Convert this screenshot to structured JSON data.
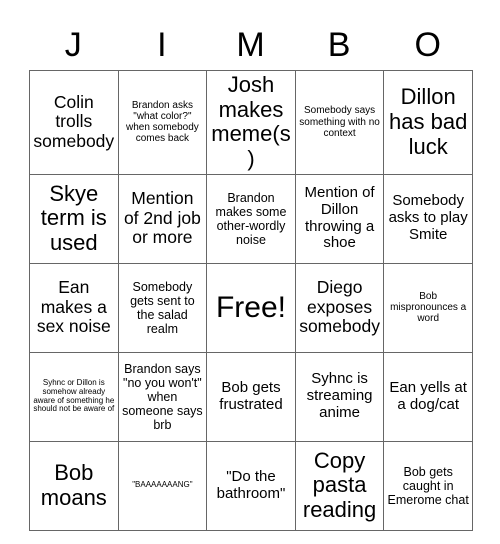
{
  "card": {
    "title_letters": [
      "J",
      "I",
      "M",
      "B",
      "O"
    ],
    "rows": [
      [
        {
          "text": "Colin trolls somebody",
          "size": "fs-lg"
        },
        {
          "text": "Brandon asks \"what color?\" when somebody comes back",
          "size": "fs-xs"
        },
        {
          "text": "Josh makes meme(s)",
          "size": "fs-xl"
        },
        {
          "text": "Somebody says something with no context",
          "size": "fs-xs"
        },
        {
          "text": "Dillon has bad luck",
          "size": "fs-xl"
        }
      ],
      [
        {
          "text": "Skye term is used",
          "size": "fs-xl"
        },
        {
          "text": "Mention of 2nd job or more",
          "size": "fs-lg"
        },
        {
          "text": "Brandon makes some other-wordly noise",
          "size": "fs-sm"
        },
        {
          "text": "Mention of Dillon throwing a shoe",
          "size": "fs-md"
        },
        {
          "text": "Somebody asks to play Smite",
          "size": "fs-md"
        }
      ],
      [
        {
          "text": "Ean makes a sex noise",
          "size": "fs-lg"
        },
        {
          "text": "Somebody gets sent to the salad realm",
          "size": "fs-sm"
        },
        {
          "text": "Free!",
          "size": "fs-free"
        },
        {
          "text": "Diego exposes somebody",
          "size": "fs-lg"
        },
        {
          "text": "Bob mispronounces a word",
          "size": "fs-xs"
        }
      ],
      [
        {
          "text": "Syhnc or Dillon is somehow already aware of something he should not be aware of",
          "size": "fs-xxs"
        },
        {
          "text": "Brandon says \"no you won't\" when someone says brb",
          "size": "fs-sm"
        },
        {
          "text": "Bob gets frustrated",
          "size": "fs-md"
        },
        {
          "text": "Syhnc is streaming anime",
          "size": "fs-md"
        },
        {
          "text": "Ean yells at a dog/cat",
          "size": "fs-md"
        }
      ],
      [
        {
          "text": "Bob moans",
          "size": "fs-xl"
        },
        {
          "text": "\"BAAAAAAANG\"",
          "size": "fs-xxs"
        },
        {
          "text": "\"Do the bathroom\"",
          "size": "fs-md"
        },
        {
          "text": "Copy pasta reading",
          "size": "fs-xl"
        },
        {
          "text": "Bob gets caught in Emerome chat",
          "size": "fs-sm"
        }
      ]
    ]
  },
  "colors": {
    "background": "#ffffff",
    "text": "#000000",
    "grid_line": "#666666"
  }
}
